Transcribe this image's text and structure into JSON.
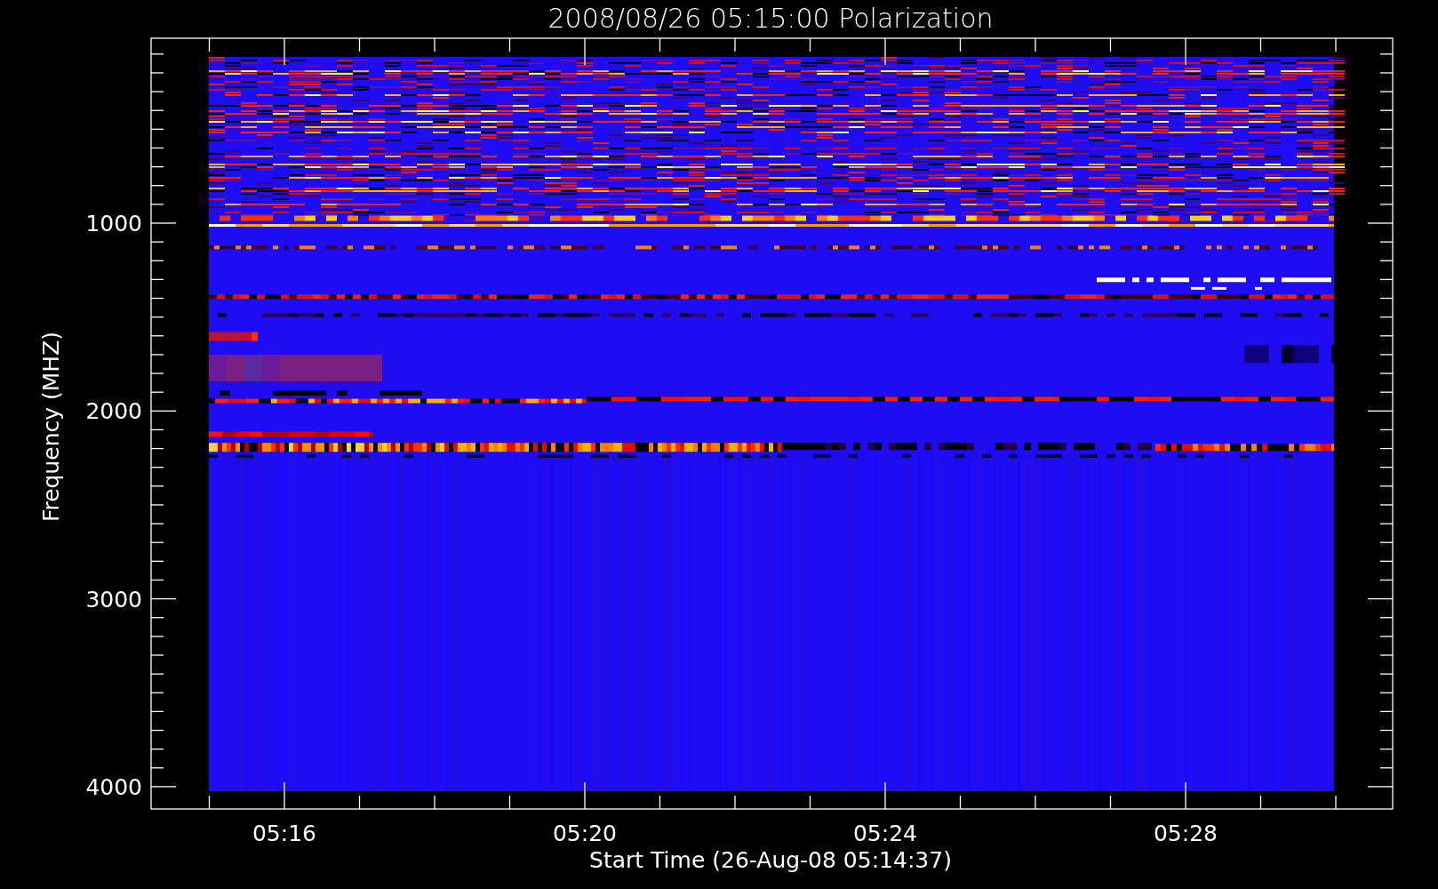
{
  "chart": {
    "title": "2008/08/26 05:15:00 Polarization",
    "ylabel": "Frequency (MHZ)",
    "xlabel": "Start Time (26-Aug-08 05:14:37)",
    "yticks": [
      "1000",
      "2000",
      "3000",
      "4000"
    ],
    "xticks": [
      "05:16",
      "05:20",
      "05:24",
      "05:28"
    ]
  }
}
